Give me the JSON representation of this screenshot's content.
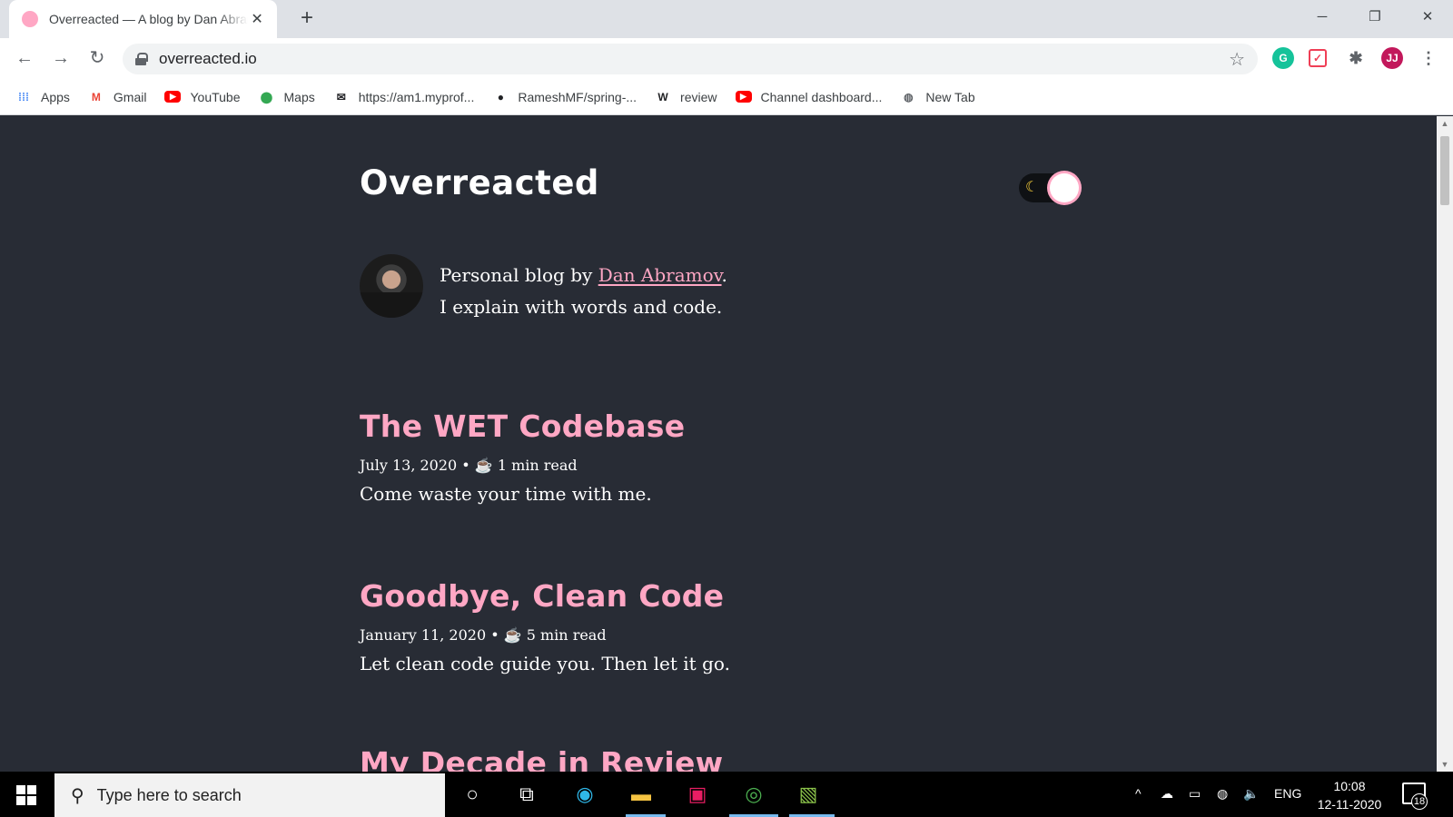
{
  "browser": {
    "tab_title": "Overreacted — A blog by Dan Abramov",
    "url": "overreacted.io",
    "bookmarks": [
      {
        "label": "Apps",
        "icon": "apps-grid-icon",
        "color": "#4285f4"
      },
      {
        "label": "Gmail",
        "icon": "gmail-icon",
        "color": "#ea4335"
      },
      {
        "label": "YouTube",
        "icon": "youtube-icon",
        "color": "#ff0000"
      },
      {
        "label": "Maps",
        "icon": "maps-pin-icon",
        "color": "#34a853"
      },
      {
        "label": "https://am1.myprof...",
        "icon": "envelope-icon",
        "color": "#202124"
      },
      {
        "label": "RameshMF/spring-...",
        "icon": "github-icon",
        "color": "#202124"
      },
      {
        "label": "review",
        "icon": "wikipedia-icon",
        "color": "#202124"
      },
      {
        "label": "Channel dashboard...",
        "icon": "youtube-icon",
        "color": "#ff0000"
      },
      {
        "label": "New Tab",
        "icon": "globe-icon",
        "color": "#5f6368"
      }
    ]
  },
  "blog": {
    "title": "Overreacted",
    "bio_prefix": "Personal blog by ",
    "author": "Dan Abramov",
    "bio_suffix": ".",
    "bio_line2": "I explain with words and code.",
    "accent_color": "#ffa7c4",
    "background_color": "#282c35",
    "posts": [
      {
        "title": "The WET Codebase",
        "meta": "July 13, 2020 • ☕️ 1 min read",
        "excerpt": "Come waste your time with me."
      },
      {
        "title": "Goodbye, Clean Code",
        "meta": "January 11, 2020 • ☕️ 5 min read",
        "excerpt": "Let clean code guide you. Then let it go."
      },
      {
        "title": "My Decade in Review",
        "meta": "",
        "excerpt": ""
      }
    ]
  },
  "taskbar": {
    "search_placeholder": "Type here to search",
    "language": "ENG",
    "time": "10:08",
    "date": "12-11-2020",
    "notification_count": "18"
  }
}
